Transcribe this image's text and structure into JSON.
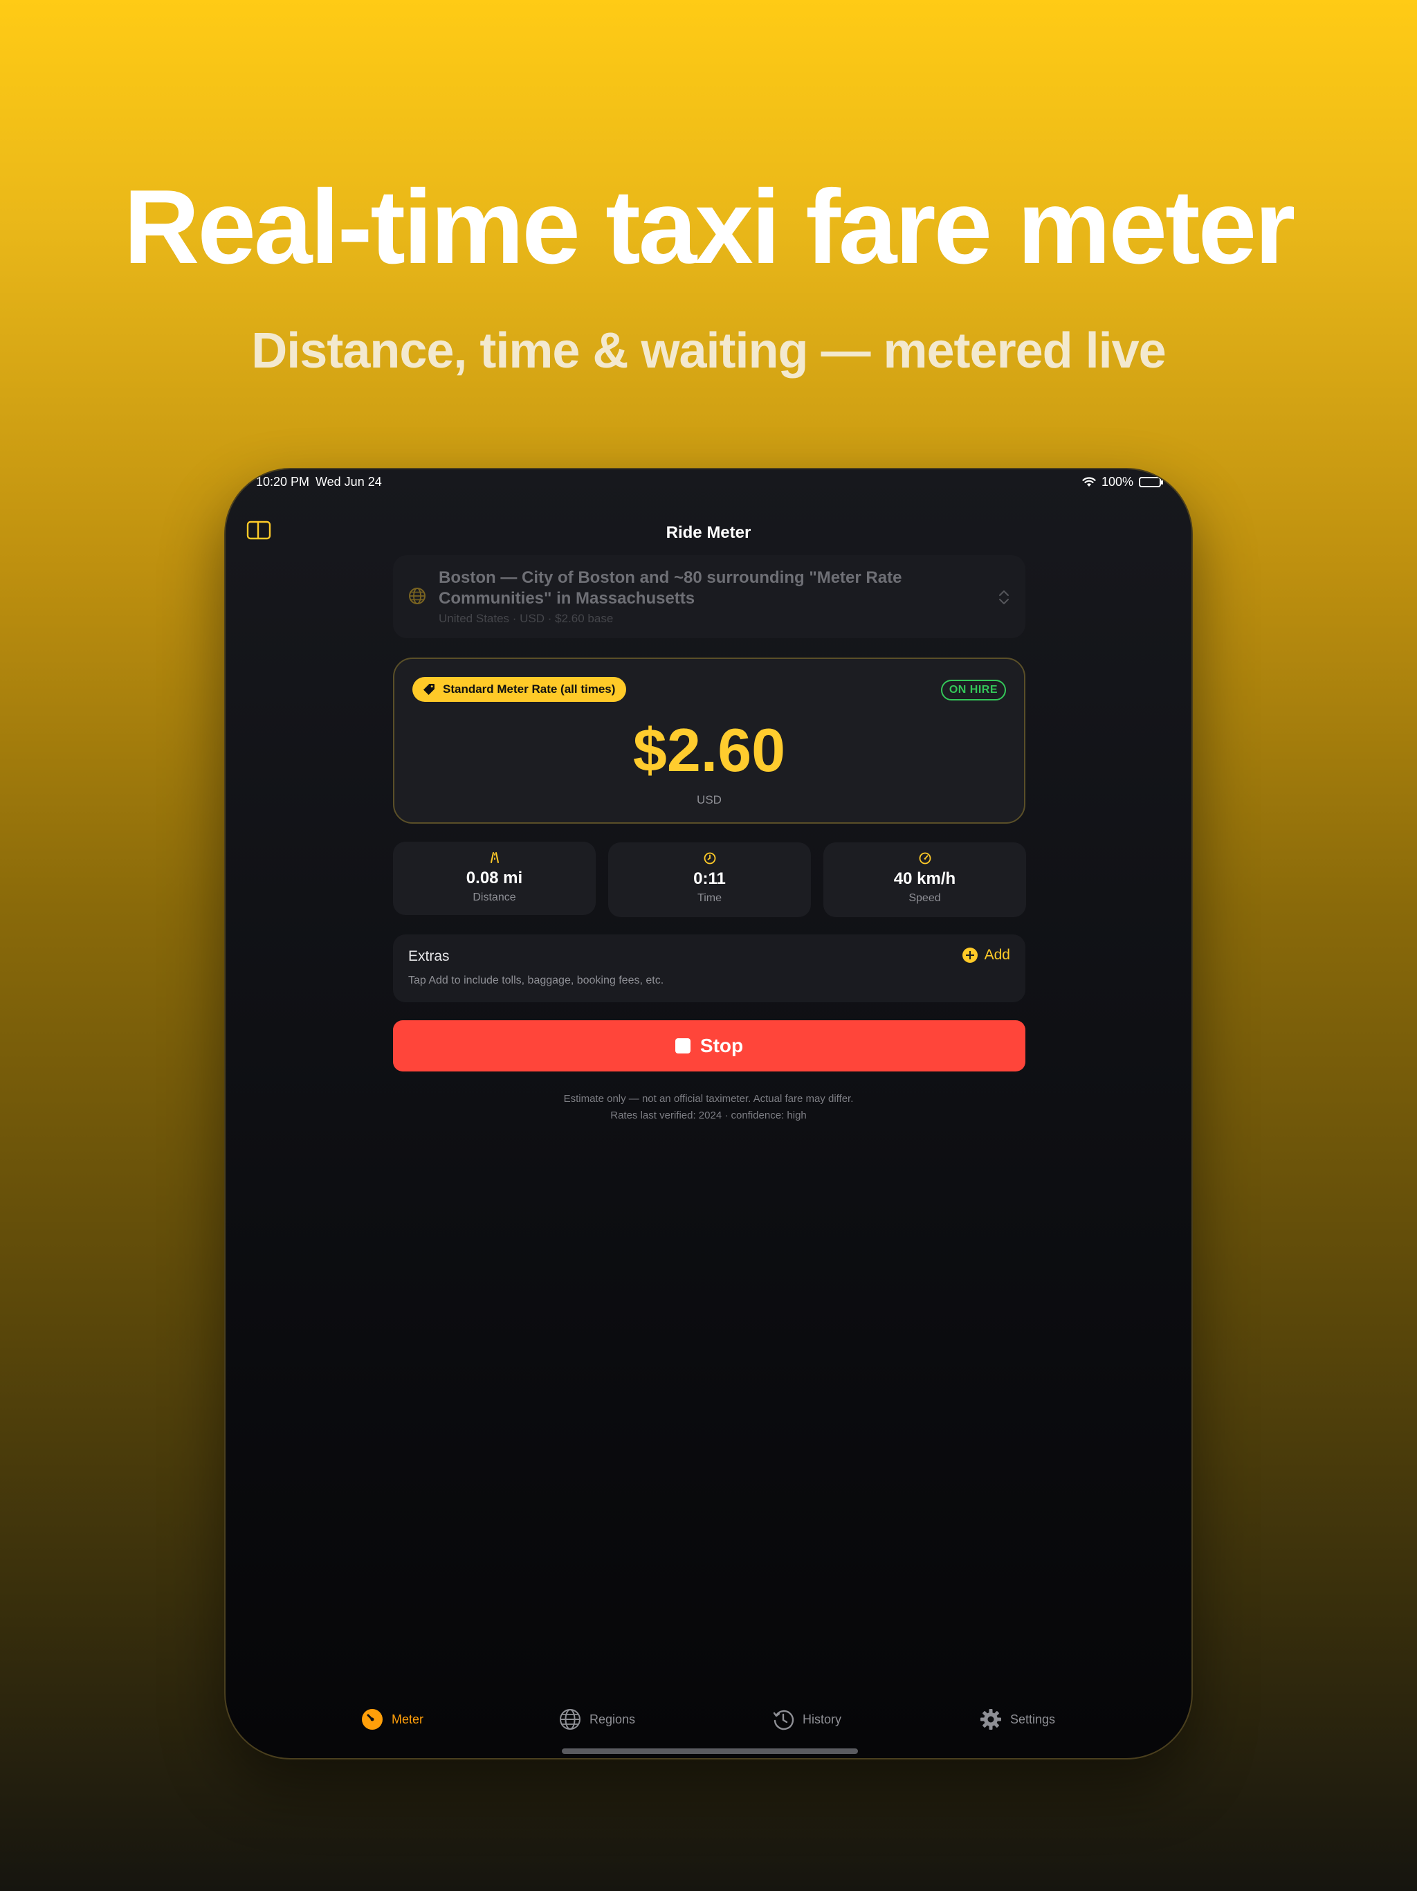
{
  "marketing": {
    "headline": "Real-time taxi fare meter",
    "subheadline": "Distance, time & waiting — metered live"
  },
  "status_bar": {
    "time": "10:20 PM",
    "date": "Wed Jun 24",
    "battery": "100%"
  },
  "nav": {
    "title": "Ride Meter"
  },
  "region": {
    "title": "Boston — City of Boston and ~80 surrounding \"Meter Rate Communities\" in Massachusetts",
    "subtitle": "United States  ·  USD  ·  $2.60 base"
  },
  "fare": {
    "rate_name": "Standard Meter Rate (all times)",
    "status": "ON HIRE",
    "amount": "$2.60",
    "currency": "USD"
  },
  "stats": [
    {
      "value": "0.08 mi",
      "label": "Distance",
      "icon": "road-icon"
    },
    {
      "value": "0:11",
      "label": "Time",
      "icon": "clock-icon"
    },
    {
      "value": "40 km/h",
      "label": "Speed",
      "icon": "speedometer-icon"
    }
  ],
  "extras": {
    "title": "Extras",
    "add_label": "Add",
    "help": "Tap Add to include tolls, baggage, booking fees, etc."
  },
  "stop_label": "Stop",
  "disclaimer": {
    "line1": "Estimate only — not an official taximeter. Actual fare may differ.",
    "line2": "Rates last verified: 2024 · confidence: high"
  },
  "tabs": [
    {
      "label": "Meter",
      "icon": "meter-icon",
      "active": true
    },
    {
      "label": "Regions",
      "icon": "globe-icon",
      "active": false
    },
    {
      "label": "History",
      "icon": "history-icon",
      "active": false
    },
    {
      "label": "Settings",
      "icon": "gear-icon",
      "active": false
    }
  ],
  "colors": {
    "accent": "#FFCA28",
    "tab_active": "#FF9F0A",
    "on_hire": "#34C759",
    "stop": "#FF453A",
    "background": "#0E0F13"
  }
}
